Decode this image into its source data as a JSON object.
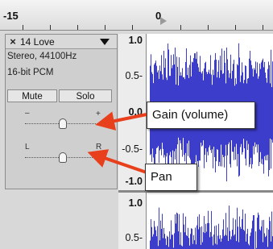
{
  "ruler": {
    "left_label": "-15",
    "zero_label": "0"
  },
  "track": {
    "close_glyph": "×",
    "name": "14 Love",
    "info_line1": "Stereo, 44100Hz",
    "info_line2": "16-bit PCM",
    "mute_label": "Mute",
    "solo_label": "Solo",
    "gain_minus": "–",
    "gain_plus": "+",
    "pan_left": "L",
    "pan_right": "R",
    "gain_level": 0.5,
    "pan_level": 0.5
  },
  "scale": {
    "ch1_top": "1.0",
    "ch1_half": "0.5-",
    "ch1_zero": "0.0",
    "ch1_neg_half": "-0.5-",
    "ch1_bottom": "-1.0",
    "ch2_top": "1.0",
    "ch2_half": "0.5-"
  },
  "annotations": {
    "gain": "Gain (volume)",
    "pan": "Pan"
  },
  "colors": {
    "waveform": "#3d3dcc",
    "arrow": "#e8401c",
    "panel_bg": "#cfcfcf"
  },
  "icons": [
    "close-icon",
    "dropdown-arrow-icon",
    "play-position-marker-icon",
    "arrow-icon"
  ]
}
